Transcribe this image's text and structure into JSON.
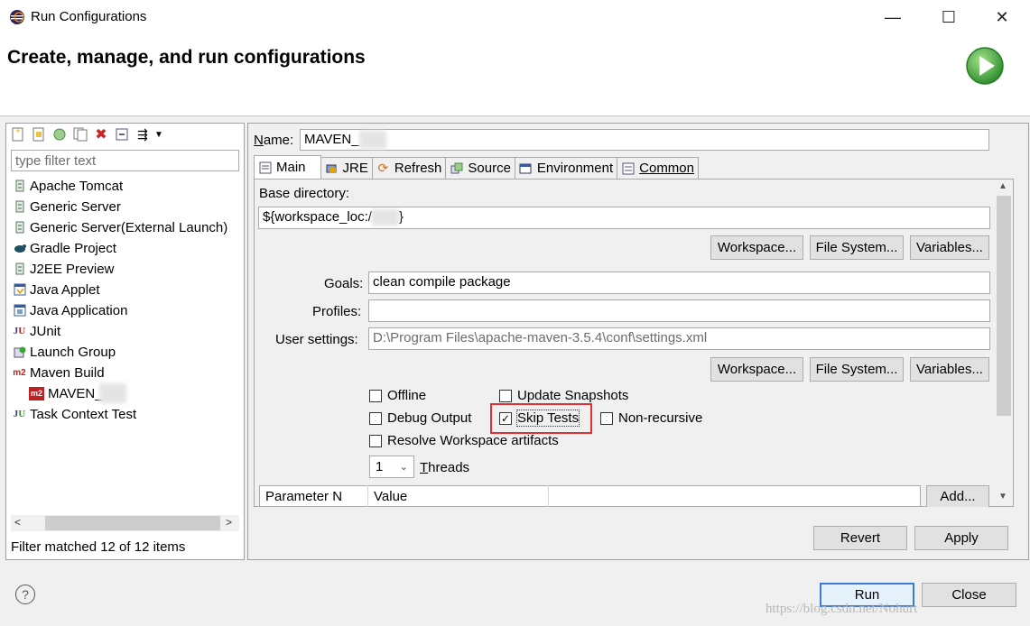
{
  "window": {
    "title": "Run Configurations",
    "minimize": "—",
    "maximize": "☐",
    "close": "✕"
  },
  "header": {
    "title": "Create, manage, and run configurations"
  },
  "left": {
    "filter_placeholder": "type filter text",
    "items": [
      {
        "label": "Apache Tomcat",
        "icon": "server-icon"
      },
      {
        "label": "Generic Server",
        "icon": "server-icon"
      },
      {
        "label": "Generic Server(External Launch)",
        "icon": "server-icon"
      },
      {
        "label": "Gradle Project",
        "icon": "gradle-icon"
      },
      {
        "label": "J2EE Preview",
        "icon": "server-icon"
      },
      {
        "label": "Java Applet",
        "icon": "applet-icon"
      },
      {
        "label": "Java Application",
        "icon": "java-app-icon"
      },
      {
        "label": "JUnit",
        "icon": "junit-icon"
      },
      {
        "label": "Launch Group",
        "icon": "launch-group-icon"
      },
      {
        "label": "Maven Build",
        "icon": "maven-icon"
      },
      {
        "label": "MAVEN_",
        "icon": "maven-icon"
      },
      {
        "label": "Task Context Test",
        "icon": "task-icon"
      }
    ],
    "status": "Filter matched 12 of 12 items"
  },
  "right": {
    "name_label": "Name:",
    "name_value": "MAVEN_",
    "tabs": [
      {
        "label": "Main",
        "icon": "main-tab-icon"
      },
      {
        "label": "JRE",
        "icon": "jre-icon"
      },
      {
        "label": "Refresh",
        "icon": "refresh-icon"
      },
      {
        "label": "Source",
        "icon": "source-icon"
      },
      {
        "label": "Environment",
        "icon": "environment-icon"
      },
      {
        "label": "Common",
        "icon": "common-icon"
      }
    ],
    "base_directory_label": "Base directory:",
    "base_directory_value": "${workspace_loc:/",
    "btn_workspace": "Workspace...",
    "btn_filesystem": "File System...",
    "btn_variables": "Variables...",
    "goals_label": "Goals:",
    "goals_value": "clean compile package",
    "profiles_label": "Profiles:",
    "profiles_value": "",
    "user_settings_label": "User settings:",
    "user_settings_value": "D:\\Program Files\\apache-maven-3.5.4\\conf\\settings.xml",
    "checkboxes": {
      "offline": {
        "label": "Offline",
        "checked": false
      },
      "update_snapshots": {
        "label": "Update Snapshots",
        "checked": false
      },
      "debug_output": {
        "label": "Debug Output",
        "checked": false
      },
      "skip_tests": {
        "label": "Skip Tests",
        "checked": true
      },
      "non_recursive": {
        "label": "Non-recursive",
        "checked": false
      },
      "resolve_workspace": {
        "label": "Resolve Workspace artifacts",
        "checked": false
      }
    },
    "threads_value": "1",
    "threads_label": "Threads",
    "param_col_name": "Parameter N",
    "param_col_value": "Value",
    "btn_add": "Add...",
    "btn_revert": "Revert",
    "btn_apply": "Apply"
  },
  "footer": {
    "btn_run": "Run",
    "btn_close": "Close",
    "help": "?",
    "watermark": "https://blog.csdn.net/Nohurt"
  },
  "colors": {
    "highlight": "#e03030",
    "run_logo": "#3aa63a",
    "button_bg": "#e1e1e1",
    "panel_bg": "#f0f0f0"
  }
}
